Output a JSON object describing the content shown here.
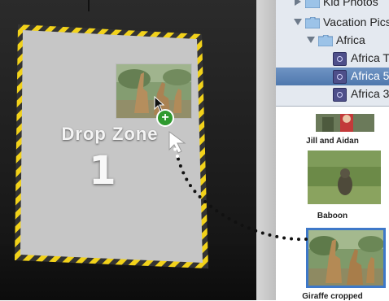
{
  "drop_zone": {
    "label": "Drop Zone",
    "number": "1"
  },
  "sidebar": {
    "items": [
      {
        "label": "Kid Photos",
        "type": "folder",
        "level": 0,
        "expanded": false,
        "selected": false
      },
      {
        "label": "Vacation Pics",
        "type": "folder",
        "level": 0,
        "expanded": true,
        "selected": false
      },
      {
        "label": "Africa",
        "type": "folder",
        "level": 1,
        "expanded": true,
        "selected": false
      },
      {
        "label": "Africa T",
        "type": "event",
        "level": 2,
        "selected": false
      },
      {
        "label": "Africa 5",
        "type": "event",
        "level": 2,
        "selected": true
      },
      {
        "label": "Africa 3",
        "type": "event",
        "level": 2,
        "selected": false
      }
    ]
  },
  "photos": {
    "items": [
      {
        "caption": "Jill and Aidan",
        "selected": false
      },
      {
        "caption": "Baboon",
        "selected": false
      },
      {
        "caption": "Giraffe cropped",
        "selected": true
      }
    ]
  },
  "drag": {
    "badge": "+"
  },
  "colors": {
    "selection": "#4f78ad",
    "stripe_yellow": "#f2d21a",
    "stripe_dark": "#333333",
    "drop_zone_fill": "#c4c4c4",
    "badge_green": "#2f9a2f"
  }
}
